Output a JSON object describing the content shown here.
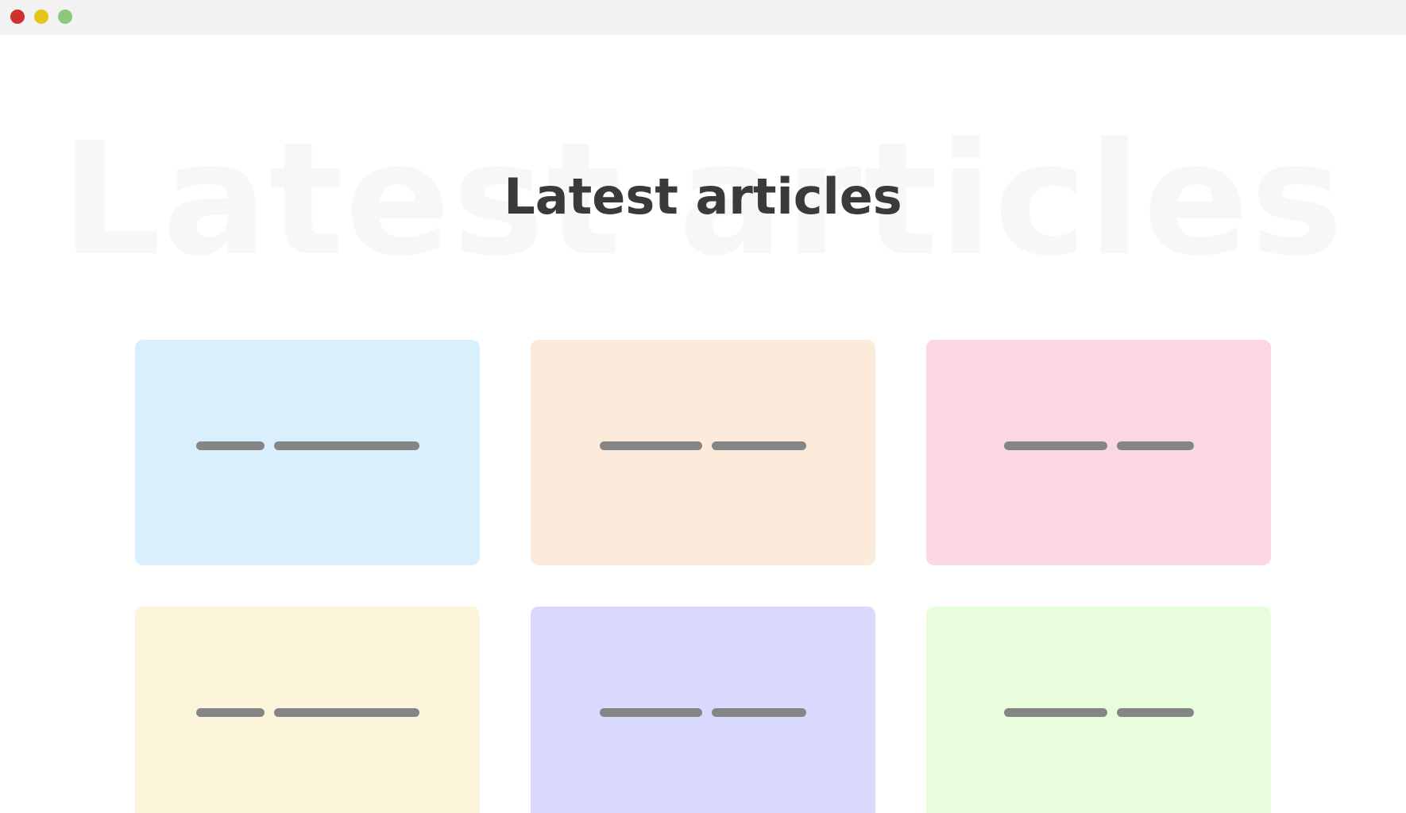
{
  "window": {
    "controls": [
      {
        "name": "close",
        "color": "#d0312d"
      },
      {
        "name": "minimize",
        "color": "#e6c419"
      },
      {
        "name": "maximize",
        "color": "#8fc77e"
      }
    ]
  },
  "page": {
    "background_title": "Latest articles",
    "title": "Latest articles"
  },
  "colors": {
    "title": "#3a3a3a",
    "background_title": "#f7f7f7",
    "placeholder_bar": "#858585"
  },
  "cards": [
    {
      "color": "#d9effd"
    },
    {
      "color": "#fcebdb"
    },
    {
      "color": "#fbd7e3"
    },
    {
      "color": "#fdf5db"
    },
    {
      "color": "#d8d9fc"
    },
    {
      "color": "#e7fddb"
    }
  ]
}
